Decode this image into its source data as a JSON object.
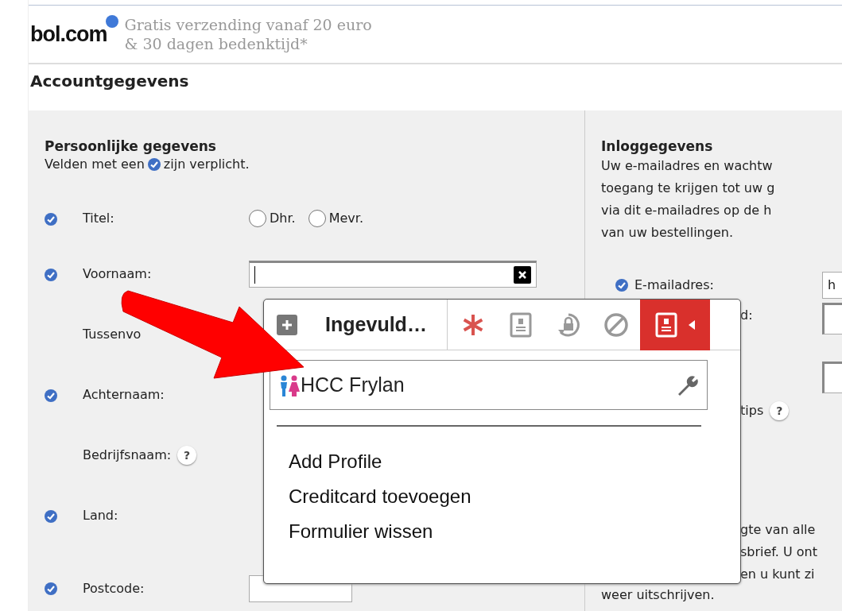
{
  "header": {
    "logo": "bol.com",
    "tagline_lines": [
      "Gratis verzending vanaf 20 euro",
      "& 30 dagen bedenktijd*"
    ]
  },
  "page_title": "Accountgegevens",
  "personal": {
    "title": "Persoonlijke gegevens",
    "note_before": "Velden met een",
    "note_after": "zijn verplicht.",
    "fields": [
      {
        "label": "Titel:",
        "required": true,
        "kind": "radio",
        "options": [
          {
            "label": "Dhr.",
            "selected": false
          },
          {
            "label": "Mevr.",
            "selected": false
          }
        ]
      },
      {
        "label": "Voornaam:",
        "required": true,
        "kind": "text",
        "focused": true
      },
      {
        "label": "Tussenvo",
        "required": false,
        "kind": "covered"
      },
      {
        "label": "Achternaam:",
        "required": true,
        "kind": "covered"
      },
      {
        "label": "Bedrijfsnaam:",
        "required": false,
        "kind": "covered",
        "help": "?"
      },
      {
        "label": "Land:",
        "required": true,
        "kind": "covered"
      },
      {
        "label": "Postcode:",
        "required": true,
        "kind": "text",
        "focused": false
      }
    ]
  },
  "login": {
    "title": "Inloggegevens",
    "intro_lines": [
      "Uw e-mailadres en wachtw",
      "toegang te krijgen tot uw g",
      "via dit e-mailadres op de h",
      "van uw bestellingen."
    ],
    "fields": [
      {
        "label": "E-mailadres:",
        "required": true,
        "value": "h"
      },
      {
        "label": "d:",
        "required": false
      },
      {
        "label": "tips",
        "required": false,
        "help": "?"
      }
    ],
    "newsletter_lines": [
      "gte van alle",
      "sbrief. U ont",
      "en u kunt zi"
    ],
    "newsletter_last": "weer uitschrijven."
  },
  "popup": {
    "title": "Ingevuld…",
    "tools": [
      {
        "kind": "asterisk",
        "selected": false
      },
      {
        "kind": "card",
        "selected": false
      },
      {
        "kind": "lock",
        "selected": false
      },
      {
        "kind": "ban",
        "selected": false
      },
      {
        "kind": "card",
        "selected": true
      }
    ],
    "profiles": [
      {
        "name": "HCC Frylan"
      }
    ],
    "menu": [
      "Add Profile",
      "Creditcard toevoegen",
      "Formulier wissen"
    ]
  }
}
